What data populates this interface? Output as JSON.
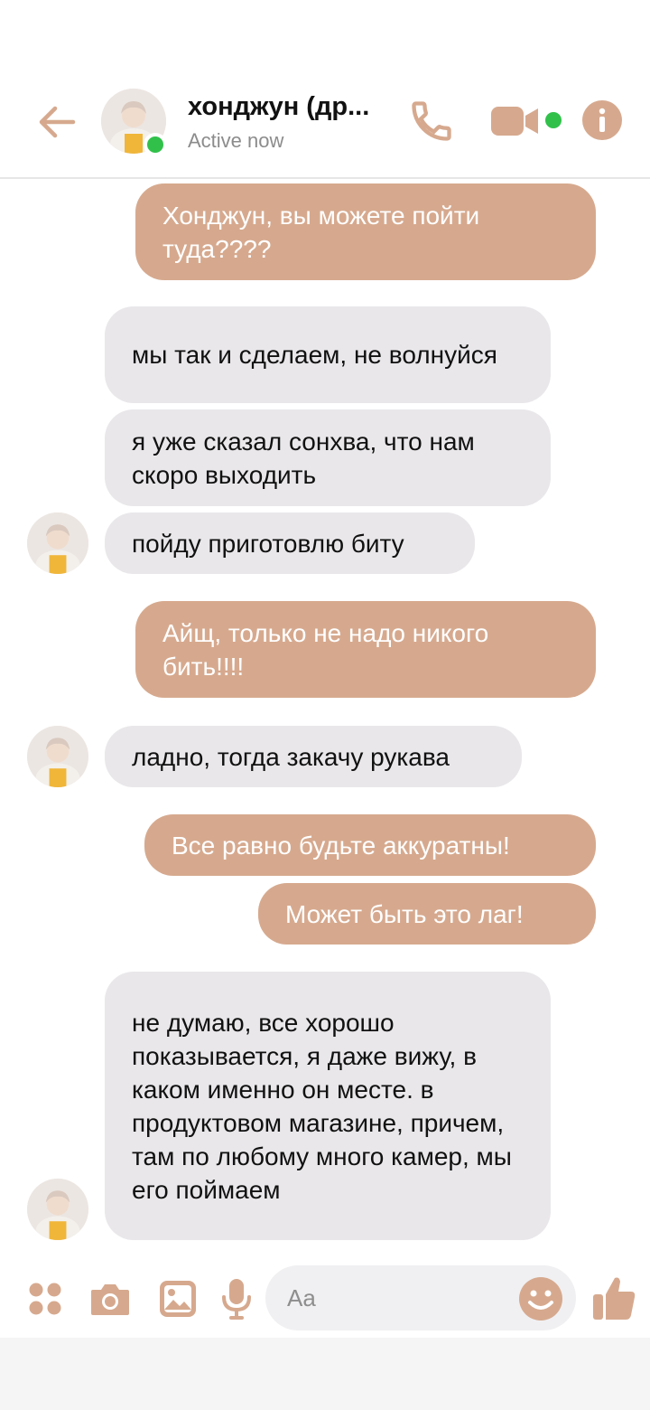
{
  "header": {
    "contact_name": "хонджун (др...",
    "status": "Active now",
    "back_icon": "arrow-left-icon",
    "call_icon": "phone-icon",
    "video_icon": "video-camera-icon",
    "info_icon": "info-icon"
  },
  "colors": {
    "accent": "#d6a98e",
    "sent_bubble": "#d6a98e",
    "received_bubble": "#e9e7ea",
    "online": "#31c14b"
  },
  "messages": [
    {
      "direction": "sent",
      "text": "Хонджун, вы можете пойти туда????"
    },
    {
      "direction": "received",
      "text": "мы так и сделаем, не волнуйся"
    },
    {
      "direction": "received",
      "text": "я уже сказал сонхва, что нам скоро выходить"
    },
    {
      "direction": "received",
      "text": "пойду приготовлю биту"
    },
    {
      "direction": "sent",
      "text": "Айщ, только не надо никого бить!!!!"
    },
    {
      "direction": "received",
      "text": "ладно, тогда закачу рукава"
    },
    {
      "direction": "sent",
      "text": "Все равно будьте аккуратны!"
    },
    {
      "direction": "sent",
      "text": "Может быть это лаг!"
    },
    {
      "direction": "received",
      "text": "не думаю, все хорошо показывается, я даже вижу, в каком именно он месте. в продуктовом магазине, причем, там по любому много камер, мы его поймаем"
    }
  ],
  "composer": {
    "placeholder": "Aa",
    "icons": [
      "apps-icon",
      "camera-icon",
      "gallery-icon",
      "microphone-icon",
      "emoji-icon",
      "thumbs-up-icon"
    ]
  }
}
